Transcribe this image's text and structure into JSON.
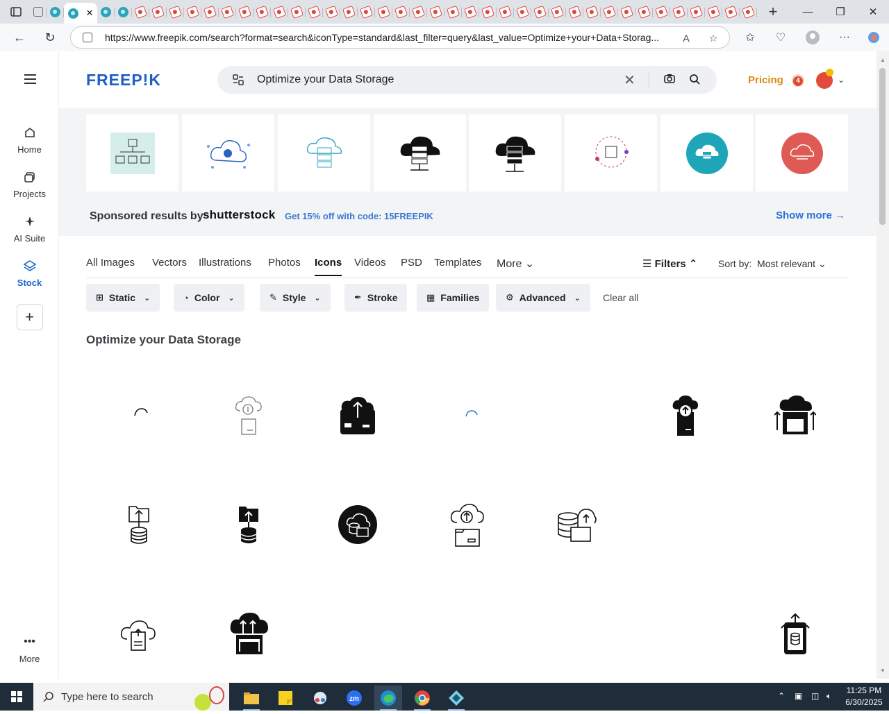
{
  "browser": {
    "url": "https://www.freepik.com/search?format=search&iconType=standard&last_filter=query&last_value=Optimize+your+Data+Storag...",
    "tab_close": "✕",
    "new_tab": "+"
  },
  "site": {
    "logo": "FREEP!K",
    "search_value": "Optimize your Data Storage",
    "pricing": "Pricing",
    "notif_count": "4"
  },
  "rail": {
    "home": "Home",
    "projects": "Projects",
    "ai_suite": "AI Suite",
    "stock": "Stock",
    "more": "More"
  },
  "sponsored": {
    "label": "Sponsored results by",
    "brand": "shutterstock",
    "promo": "Get 15% off with code: 15FREEPIK",
    "show_more": "Show more →"
  },
  "type_tabs": [
    "All Images",
    "Vectors",
    "Illustrations",
    "Photos",
    "Icons",
    "Videos",
    "PSD",
    "Templates",
    "More"
  ],
  "filters": {
    "filters_label": "Filters",
    "sort_label": "Sort by:",
    "sort_value": "Most relevant",
    "chips": [
      "Static",
      "Color",
      "Style",
      "Stroke",
      "Families",
      "Advanced"
    ],
    "clear_all": "Clear all"
  },
  "results": {
    "title": "Optimize your Data Storage"
  },
  "taskbar": {
    "search_placeholder": "Type here to search",
    "time": "11:25 PM",
    "date": "6/30/2025"
  },
  "colors": {
    "brand_blue": "#1f5ec7",
    "pricing_orange": "#d98a12",
    "link_blue": "#2c6fd6"
  }
}
